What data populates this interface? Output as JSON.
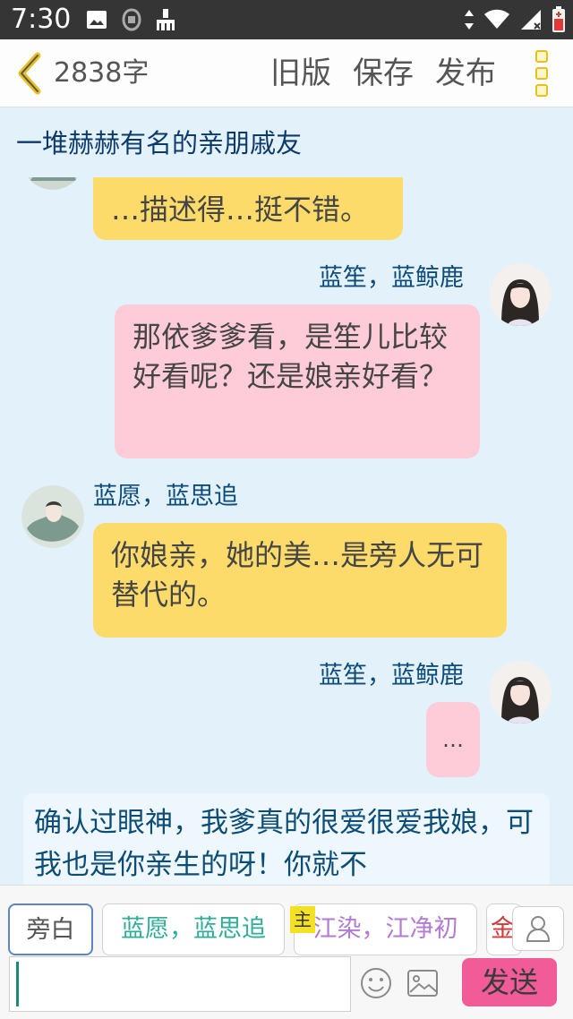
{
  "status_bar": {
    "time": "7:30",
    "icons": [
      "image-icon",
      "app-icon",
      "cleaner-icon",
      "data-arrows-icon",
      "wifi-icon",
      "signal-icon",
      "battery-icon"
    ]
  },
  "toolbar": {
    "word_count": "2838字",
    "old_version_label": "旧版",
    "save_label": "保存",
    "publish_label": "发布"
  },
  "chapter_title": "一堆赫赫有名的亲朋戚友",
  "messages": [
    {
      "speaker": "",
      "text": "…描述得…挺不错。",
      "side": "left",
      "color": "#fddb6b"
    },
    {
      "speaker": "蓝笙，蓝鲸鹿",
      "text": "那依爹爹看，是笙儿比较好看呢？还是娘亲好看？",
      "side": "right",
      "color": "#fdccd8"
    },
    {
      "speaker": "蓝愿，蓝思追",
      "text": "你娘亲，她的美…是旁人无可替代的。",
      "side": "left",
      "color": "#fddb6b"
    },
    {
      "speaker": "蓝笙，蓝鲸鹿",
      "text": "…",
      "side": "right",
      "color": "#fdccd8"
    }
  ],
  "narration": "确认过眼神，我爹真的很爱很爱我娘，可我也是你亲生的呀！你就不",
  "roles": {
    "narrator": "旁白",
    "role1": "蓝愿，蓝思追",
    "role2": "江染，江净初",
    "role3": "金",
    "main_badge": "主"
  },
  "input": {
    "value": "",
    "send_label": "发送"
  },
  "colors": {
    "accent_yellow": "#fddb6b",
    "accent_pink": "#fdccd8",
    "send": "#f15b97",
    "background": "#e3f1fb"
  }
}
